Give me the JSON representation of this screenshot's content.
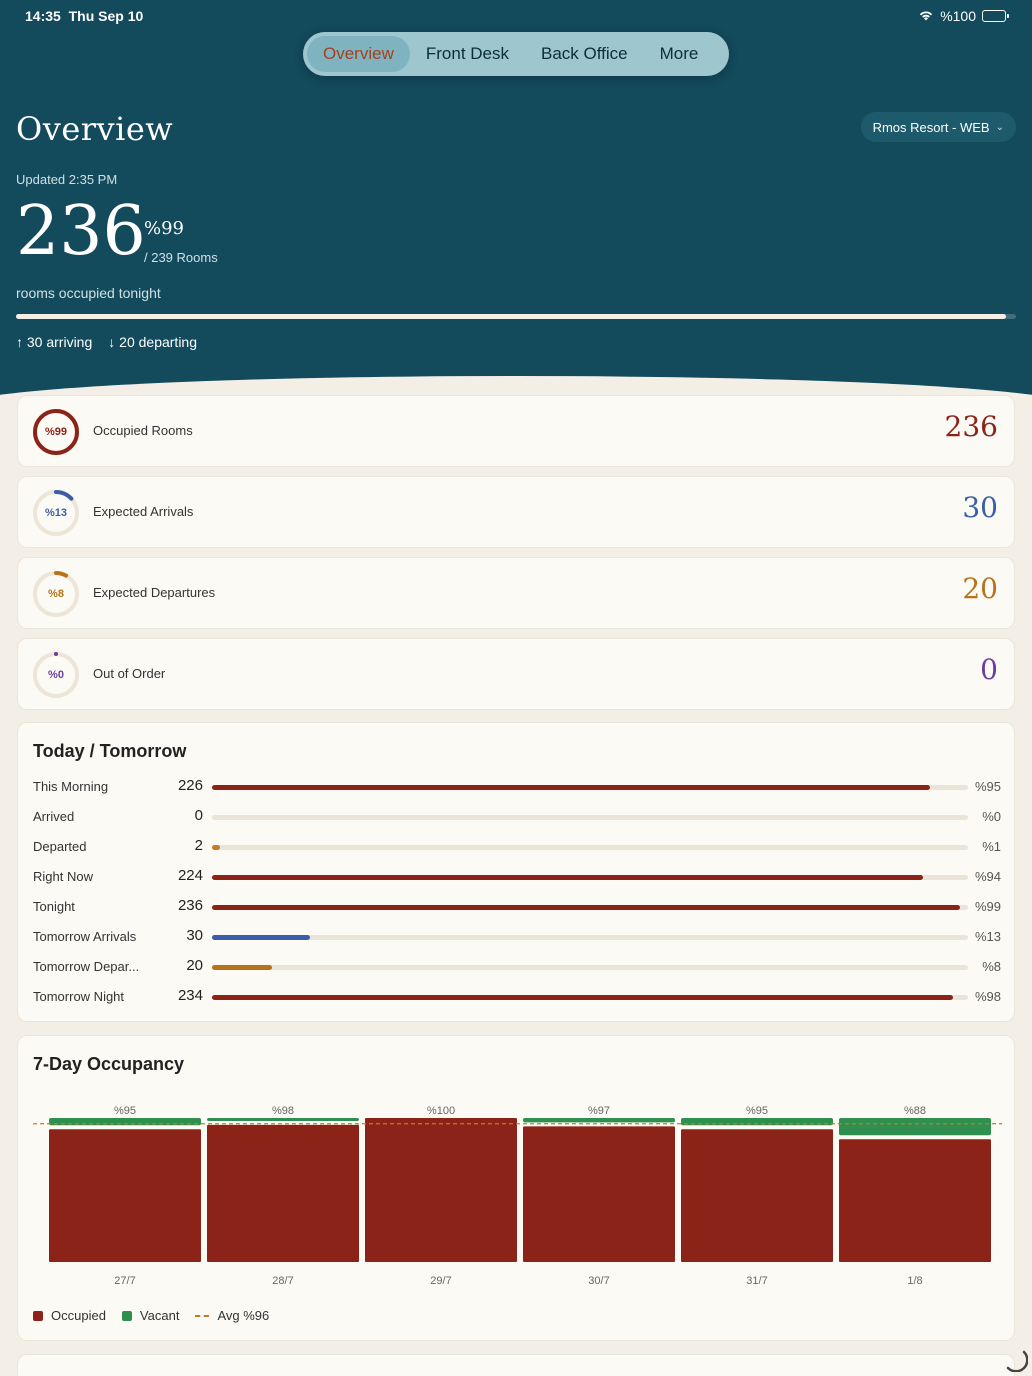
{
  "status_bar": {
    "time": "14:35",
    "date": "Thu Sep 10",
    "battery": "%100",
    "icons": [
      "wifi-icon",
      "battery-icon"
    ]
  },
  "tabs": [
    {
      "label": "Overview",
      "active": true
    },
    {
      "label": "Front Desk",
      "active": false
    },
    {
      "label": "Back Office",
      "active": false
    },
    {
      "label": "More",
      "active": false
    }
  ],
  "header": {
    "title": "Overview",
    "property": "Rmos Resort - WEB",
    "updated": "Updated 2:35 PM",
    "occupied": "236",
    "occupied_pct": "%99",
    "rooms_total": "/ 239 Rooms",
    "caption": "rooms occupied tonight",
    "occupancy_fraction": 0.99,
    "arriving": "30 arriving",
    "departing": "20 departing"
  },
  "stat_cards": [
    {
      "label": "Occupied Rooms",
      "pct_label": "%99",
      "value": "236",
      "fraction": 0.99,
      "color": "#8c2318"
    },
    {
      "label": "Expected Arrivals",
      "pct_label": "%13",
      "value": "30",
      "fraction": 0.13,
      "color": "#3a5fa8"
    },
    {
      "label": "Expected Departures",
      "pct_label": "%8",
      "value": "20",
      "fraction": 0.08,
      "color": "#b7731c"
    },
    {
      "label": "Out of Order",
      "pct_label": "%0",
      "value": "0",
      "fraction": 0,
      "color": "#6a3fa0"
    }
  ],
  "today_tomorrow": {
    "title": "Today / Tomorrow",
    "rows": [
      {
        "label": "This Morning",
        "count": "226",
        "pct": "%95",
        "fraction": 0.95,
        "color": "#8c2318"
      },
      {
        "label": "Arrived",
        "count": "0",
        "pct": "%0",
        "fraction": 0,
        "color": "#8c2318"
      },
      {
        "label": "Departed",
        "count": "2",
        "pct": "%1",
        "fraction": 0.01,
        "color": "#c47c2a"
      },
      {
        "label": "Right Now",
        "count": "224",
        "pct": "%94",
        "fraction": 0.94,
        "color": "#8c2318"
      },
      {
        "label": "Tonight",
        "count": "236",
        "pct": "%99",
        "fraction": 0.99,
        "color": "#8c2318"
      },
      {
        "label": "Tomorrow Arrivals",
        "count": "30",
        "pct": "%13",
        "fraction": 0.13,
        "color": "#3a5fa8"
      },
      {
        "label": "Tomorrow Depar...",
        "count": "20",
        "pct": "%8",
        "fraction": 0.08,
        "color": "#b7731c"
      },
      {
        "label": "Tomorrow Night",
        "count": "234",
        "pct": "%98",
        "fraction": 0.98,
        "color": "#8c2318"
      }
    ]
  },
  "occupancy_chart": {
    "title": "7-Day Occupancy",
    "legend": {
      "occupied": "Occupied",
      "vacant": "Vacant",
      "avg": "Avg %96"
    }
  },
  "chart_data": {
    "type": "bar",
    "stacked": true,
    "title": "7-Day Occupancy",
    "categories": [
      "27/7",
      "28/7",
      "29/7",
      "30/7",
      "31/7",
      "1/8"
    ],
    "bar_labels": [
      "%95",
      "%98",
      "%100",
      "%97",
      "%95",
      "%88"
    ],
    "series": [
      {
        "name": "Occupied",
        "values": [
          95,
          98,
          100,
          97,
          95,
          88
        ],
        "color": "#8c2318"
      },
      {
        "name": "Vacant",
        "values": [
          5,
          2,
          0,
          3,
          5,
          12
        ],
        "color": "#2f8f4e"
      }
    ],
    "average": 96,
    "ylim": [
      0,
      100
    ],
    "grid": false,
    "legend_position": "bottom-left"
  }
}
